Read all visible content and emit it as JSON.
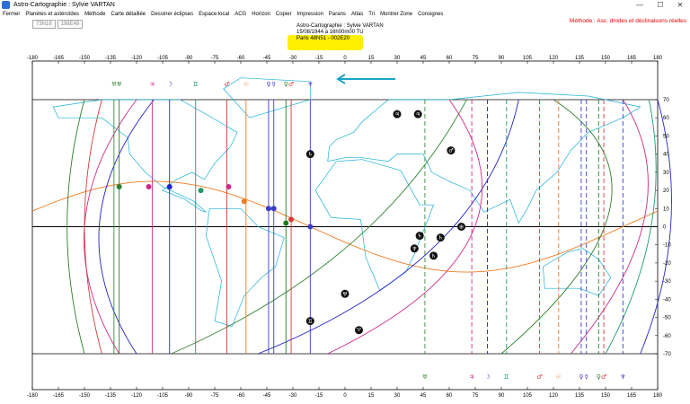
{
  "window": {
    "title": "Astro-Cartographie : Sylvie VARTAN",
    "minimize": "—",
    "maximize": "☐",
    "close": "✕"
  },
  "menu": [
    "Fermer",
    "Planètes et astéroïdes",
    "Méthode",
    "Carte détaillée",
    "Dessiner éclipses",
    "Espace local",
    "ACG",
    "Horizon",
    "Copier",
    "Impression",
    "Parans",
    "Atlas",
    "Tri",
    "Montrer Zone",
    "Consignes"
  ],
  "method_label": "Méthode : Asc. droites et déclinaisons réelles",
  "coords": [
    "73N18",
    "198E49"
  ],
  "chart_info": {
    "line1": "Astro-Cartographie : Sylvie VARTAN",
    "line2": "15/08/1944 à 16h00m00 TU",
    "line3": "Paris 48N51 - 002E20"
  },
  "colors": {
    "highlight": "#ffef00",
    "arrow": "#1aa3c8",
    "ocean": "#ffffff",
    "land_outline": "#1ab0d8"
  },
  "map": {
    "x_ticks": [
      "-180",
      "-165",
      "-150",
      "-135",
      "-120",
      "-105",
      "-90",
      "-75",
      "-60",
      "-45",
      "-30",
      "-15",
      "0",
      "15",
      "30",
      "45",
      "60",
      "75",
      "90",
      "105",
      "120",
      "135",
      "150",
      "165",
      "180"
    ],
    "y_ticks": [
      "70",
      "60",
      "50",
      "40",
      "30",
      "20",
      "10",
      "0",
      "-10",
      "-20",
      "-30",
      "-40",
      "-50",
      "-60",
      "-70"
    ],
    "lines": [
      {
        "lon": -133,
        "color": "#3a8a3a",
        "glyph": "♅"
      },
      {
        "lon": -130,
        "color": "#2e7d2e",
        "glyph": "♅"
      },
      {
        "lon": -111,
        "color": "#cc2b8a",
        "glyph": "♃"
      },
      {
        "lon": -101,
        "color": "#2424c8",
        "glyph": "☽"
      },
      {
        "lon": -86,
        "color": "#1f9a6b",
        "glyph": "♊"
      },
      {
        "lon": -68,
        "color": "#d43a3a",
        "glyph": "♂"
      },
      {
        "lon": -57,
        "color": "#f07a20",
        "glyph": "☉"
      },
      {
        "lon": -44,
        "color": "#3b3bd0",
        "glyph": "♀"
      },
      {
        "lon": -41,
        "color": "#3b3bd0",
        "glyph": "☿"
      },
      {
        "lon": -34,
        "color": "#1f7d1f",
        "glyph": "♀"
      },
      {
        "lon": -31,
        "color": "#d43a3a",
        "glyph": "♂"
      },
      {
        "lon": -20,
        "color": "#3b3bd0",
        "glyph": "♆"
      },
      {
        "lon": 46,
        "color": "#3a8a3a",
        "glyph": "♅"
      },
      {
        "lon": 73,
        "color": "#cc2b8a",
        "glyph": "♃"
      },
      {
        "lon": 82,
        "color": "#2424c8",
        "glyph": "☽"
      },
      {
        "lon": 93,
        "color": "#1f9a6b",
        "glyph": "♊"
      },
      {
        "lon": 112,
        "color": "#d43a3a",
        "glyph": "♂"
      },
      {
        "lon": 123,
        "color": "#f07a20",
        "glyph": "☉"
      },
      {
        "lon": 136,
        "color": "#3b3bd0",
        "glyph": "♀"
      },
      {
        "lon": 139,
        "color": "#3b3bd0",
        "glyph": "☿"
      },
      {
        "lon": 146,
        "color": "#1f7d1f",
        "glyph": "♀"
      },
      {
        "lon": 149,
        "color": "#d43a3a",
        "glyph": "♂"
      },
      {
        "lon": 160,
        "color": "#3b3bd0",
        "glyph": "♆"
      }
    ],
    "top_glyph_row": [
      "♅",
      "♃",
      "☽",
      "♊",
      "☉",
      "♀",
      "☿",
      "♀",
      "♂",
      "♆"
    ],
    "bottom_glyph_row": [
      "♅",
      "♃",
      "☽",
      "♊",
      "♂",
      "☉",
      "♀",
      "☿",
      "♀",
      "♂",
      "♆"
    ],
    "black_points": [
      {
        "lon": 30,
        "lat": 62,
        "g": "♃"
      },
      {
        "lon": 42,
        "lat": 62,
        "g": "♃"
      },
      {
        "lon": 61,
        "lat": 42,
        "g": "♂"
      },
      {
        "lon": -20,
        "lat": 40,
        "g": "♄"
      },
      {
        "lon": 67,
        "lat": 0,
        "g": "⊕"
      },
      {
        "lon": 43,
        "lat": -5,
        "g": "♄"
      },
      {
        "lon": 55,
        "lat": -6,
        "g": "♄"
      },
      {
        "lon": 40,
        "lat": -12,
        "g": "♆"
      },
      {
        "lon": 51,
        "lat": -16,
        "g": "♄"
      },
      {
        "lon": 0,
        "lat": -37,
        "g": "♅"
      },
      {
        "lon": -20,
        "lat": -52,
        "g": "♊"
      },
      {
        "lon": 8,
        "lat": -57,
        "g": "♈"
      }
    ]
  }
}
